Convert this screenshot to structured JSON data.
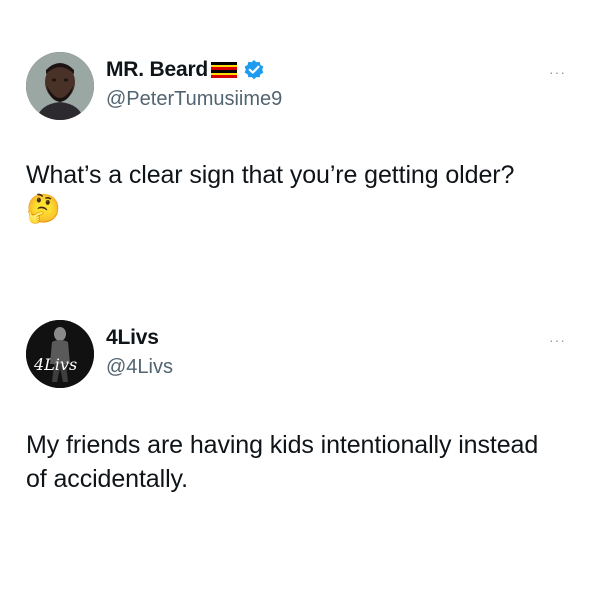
{
  "tweets": [
    {
      "display_name": "MR. Beard",
      "handle": "@PeterTumusiime9",
      "verified": true,
      "flag": "uganda",
      "more_label": "···",
      "text": "What’s a clear sign that you’re getting older?",
      "emoji": "🤔"
    },
    {
      "display_name": "4Livs",
      "handle": "@4Livs",
      "verified": false,
      "more_label": "···",
      "avatar_text": "4Livs",
      "text": "My friends are having kids intentionally instead of accidentally."
    }
  ],
  "colors": {
    "text": "#0f1419",
    "secondary": "#536471",
    "verified": "#1d9bf0"
  }
}
